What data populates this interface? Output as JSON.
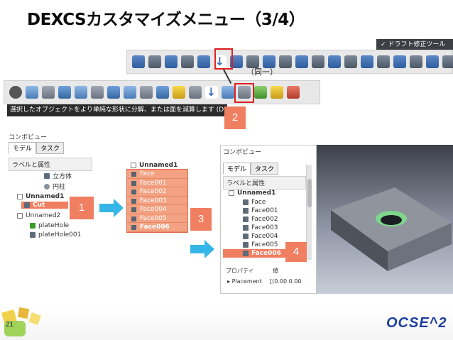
{
  "title": "DEXCSカスタマイズメニュー（3/4）",
  "draft_toolbar_label": "✓ ドラフト修正ツール",
  "same_note": "（同一）",
  "tooltip": "選択したオブジェクトをより単純な形状に分解、または面を減算します (D",
  "badges": [
    "1",
    "2",
    "3",
    "4"
  ],
  "combo_left": {
    "title": "コンボビュー",
    "tabs": [
      "モデル",
      "タスク"
    ],
    "label_header": "ラベルと属性",
    "items": [
      "立方体",
      "円柱",
      "Unnamed1",
      "Cut",
      "Unnamed2",
      "plateHole",
      "plateHole001"
    ]
  },
  "middle_tree": {
    "root": "Unnamed1",
    "faces": [
      "Face",
      "Face001",
      "Face002",
      "Face003",
      "Face004",
      "Face005",
      "Face006"
    ]
  },
  "combo_right": {
    "title": "コンボビュー",
    "tabs": [
      "モデル",
      "タスク"
    ],
    "label_header": "ラベルと属性",
    "root": "Unnamed1",
    "faces": [
      "Face",
      "Face001",
      "Face002",
      "Face003",
      "Face004",
      "Face005",
      "Face006"
    ],
    "property_header": [
      "プロパティ",
      "値"
    ],
    "placement_label": "Placement",
    "placement_value": "[(0.00 0.00 "
  },
  "footer": {
    "page_number": "21",
    "brand": "OCSE^2"
  },
  "colors": {
    "highlight": "#f07e60",
    "arrow": "#36b6e6",
    "brand": "#1e3fa0",
    "box_border": "#e02020"
  }
}
